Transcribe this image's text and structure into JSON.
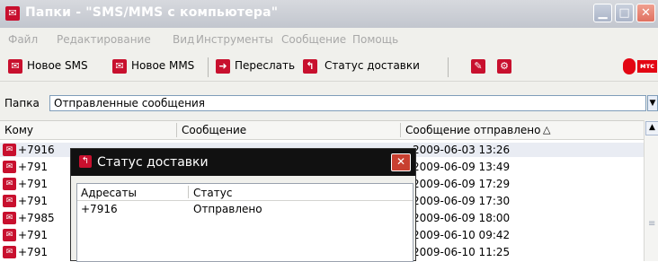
{
  "window": {
    "title": "Папки - \"SMS/MMS с компьютера\""
  },
  "menu": [
    "Файл",
    "Редактирование",
    "Вид",
    "Инструменты",
    "Сообщение",
    "Помощь"
  ],
  "toolbar": {
    "new_sms": "Новое SMS",
    "new_mms": "Новое MMS",
    "forward": "Переслать",
    "delivery_status": "Статус доставки",
    "brand": "мтс"
  },
  "folder": {
    "label": "Папка",
    "value": "Отправленные сообщения"
  },
  "list": {
    "columns": {
      "to": "Кому",
      "message": "Сообщение",
      "sent": "Сообщение отправлено"
    },
    "rows": [
      {
        "to": "+7916",
        "sent": "2009-06-03 13:26"
      },
      {
        "to": "+791",
        "sent": "2009-06-09 13:49"
      },
      {
        "to": "+791",
        "sent": "2009-06-09 17:29"
      },
      {
        "to": "+791",
        "sent": "2009-06-09 17:30"
      },
      {
        "to": "+7985",
        "sent": "2009-06-09 18:00"
      },
      {
        "to": "+791",
        "sent": "2009-06-10 09:42"
      },
      {
        "to": "+791",
        "sent": "2009-06-10 11:25"
      }
    ]
  },
  "dialog": {
    "title": "Статус доставки",
    "columns": {
      "recipients": "Адресаты",
      "status": "Статус"
    },
    "row": {
      "recipient": "+7916",
      "status": "Отправлено"
    }
  },
  "colors": {
    "accent": "#c8102e",
    "selected_row": "#e9ecf3",
    "dialog_title": "#111111"
  },
  "icons": [
    "app-icon",
    "minimize-icon",
    "maximize-icon",
    "close-icon",
    "new-sms-icon",
    "new-mms-icon",
    "forward-icon",
    "delivery-status-icon",
    "address-book-icon",
    "settings-icon",
    "mts-logo",
    "chevron-down-icon",
    "sort-asc-icon",
    "scroll-up-icon"
  ]
}
